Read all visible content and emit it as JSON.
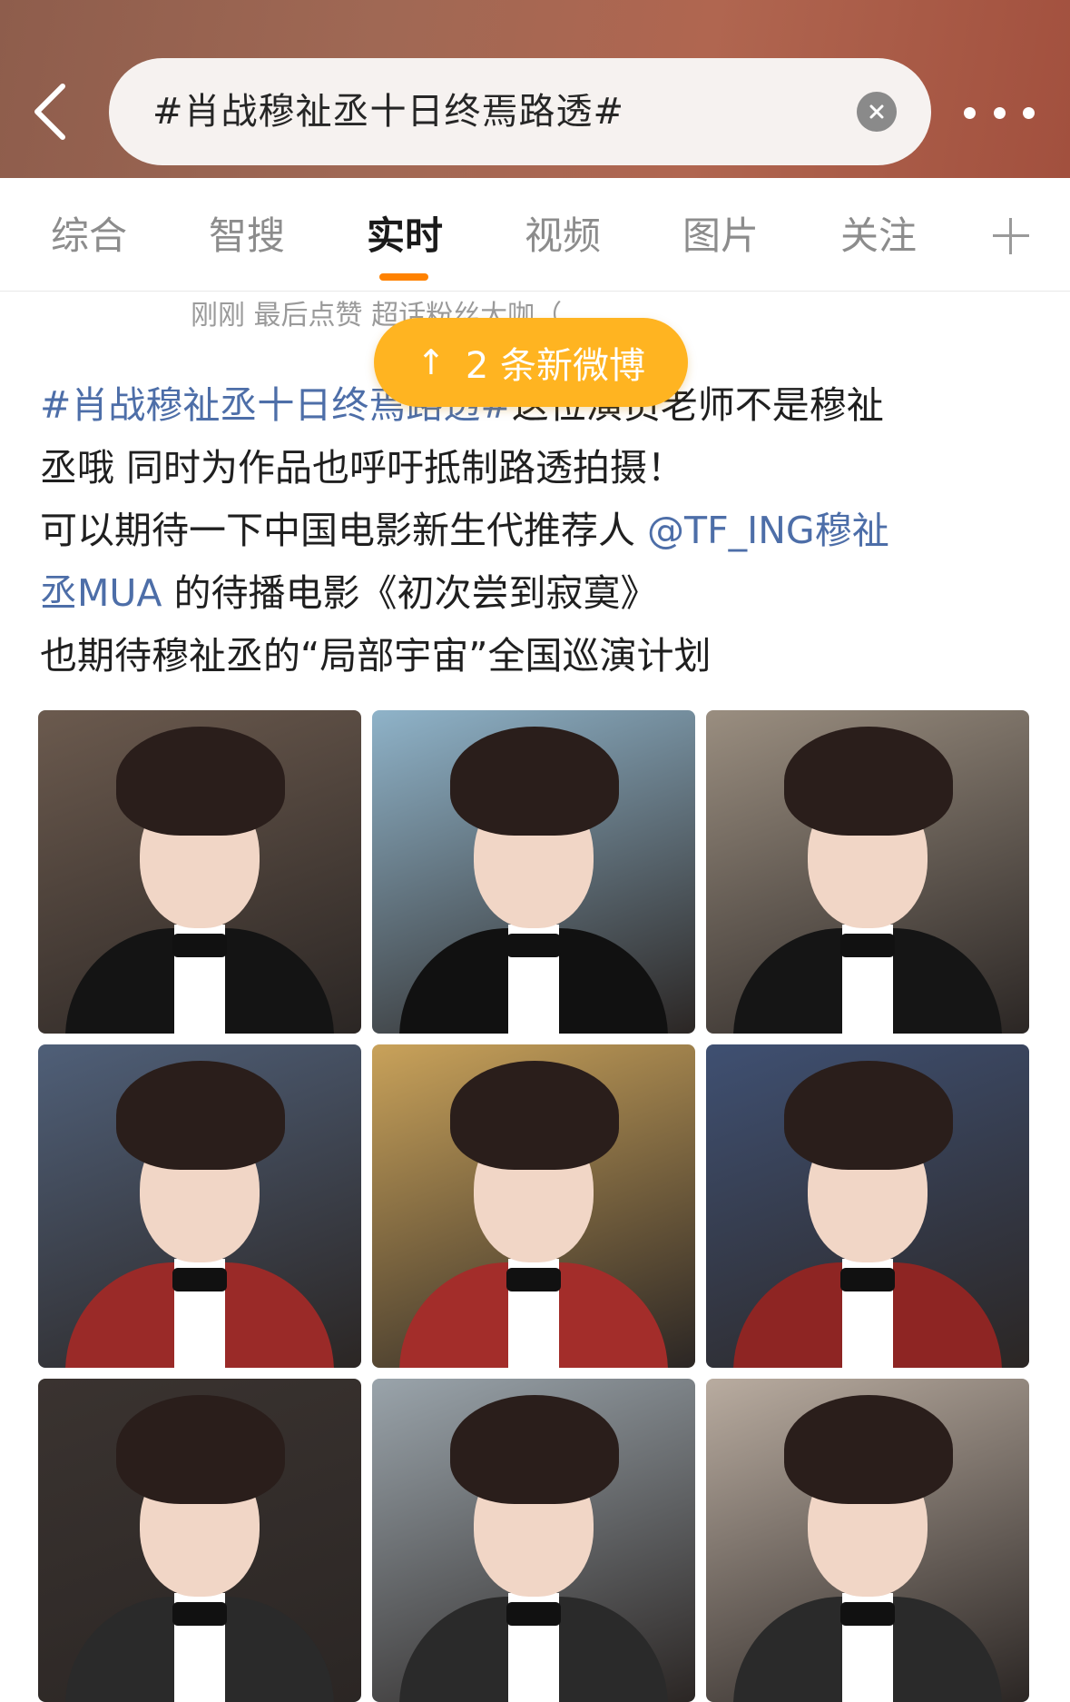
{
  "header": {
    "search_query": "#肖战穆祉丞十日终焉路透#",
    "back_icon": "chevron-left-icon",
    "clear_icon": "close-icon",
    "more_icon": "more-dots-icon"
  },
  "tabs": [
    {
      "label": "综合",
      "active": false
    },
    {
      "label": "智搜",
      "active": false
    },
    {
      "label": "实时",
      "active": true
    },
    {
      "label": "视频",
      "active": false
    },
    {
      "label": "图片",
      "active": false
    },
    {
      "label": "关注",
      "active": false
    }
  ],
  "tab_add_icon": "plus-icon",
  "feed": {
    "meta_line": "刚刚  最后点赞  超话粉丝大咖（",
    "new_posts": {
      "arrow": "↑",
      "label": "2 条新微博"
    },
    "post": {
      "hashtag": "#肖战穆祉丞十日终焉路透#",
      "line1_rest": "这位演员老师不是穆祉",
      "line2": "丞哦 同时为作品也呼吁抵制路透拍摄！",
      "line3_prefix": "可以期待一下中国电影新生代推荐人 ",
      "mention_part1": "@TF_ING穆祉",
      "mention_part2": "丞MUA",
      "line4_rest": " 的待播电影《初次尝到寂寞》",
      "line5": "也期待穆祉丞的“局部宇宙”全国巡演计划"
    },
    "photos": [
      {
        "name": "photo-1",
        "bg": "#6b5a4e",
        "outfit": "#141414"
      },
      {
        "name": "photo-2",
        "bg": "#8fb3c9",
        "outfit": "#111111"
      },
      {
        "name": "photo-3",
        "bg": "#9a8e80",
        "outfit": "#151515"
      },
      {
        "name": "photo-4",
        "bg": "#4f5f78",
        "outfit": "#9a2a28"
      },
      {
        "name": "photo-5",
        "bg": "#c9a25a",
        "outfit": "#a32d2a"
      },
      {
        "name": "photo-6",
        "bg": "#3f5072",
        "outfit": "#8e2523"
      },
      {
        "name": "photo-7",
        "bg": "#3a3330",
        "outfit": "#2a2a2a"
      },
      {
        "name": "photo-8",
        "bg": "#9aa4ab",
        "outfit": "#2a2a2a"
      },
      {
        "name": "photo-9",
        "bg": "#b9aca0",
        "outfit": "#2a2a2a"
      }
    ]
  },
  "colors": {
    "accent_orange": "#ff8200",
    "new_posts_pill": "#ffb421",
    "link_blue": "#4d6ea8"
  }
}
